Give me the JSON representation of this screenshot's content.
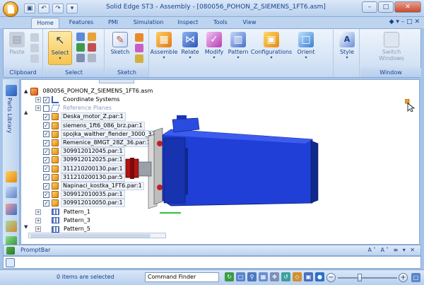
{
  "window": {
    "title": "Solid Edge ST3 - Assembly - [080056_POHON_Z_SIEMENS_1FT6.asm]",
    "minimize": "–",
    "maximize": "□",
    "close": "✕"
  },
  "qat": [
    "▣",
    "↶",
    "↷",
    "▾"
  ],
  "tabs": [
    {
      "label": "Home",
      "active": true
    },
    {
      "label": "Features"
    },
    {
      "label": "PMI"
    },
    {
      "label": "Simulation"
    },
    {
      "label": "Inspect"
    },
    {
      "label": "Tools"
    },
    {
      "label": "View"
    }
  ],
  "tabs_right": "◆ ▾ – □ ✕",
  "ribbon": {
    "groups": {
      "clipboard": "Clipboard",
      "select": "Select",
      "sketch": "Sketch",
      "window": "Window"
    },
    "buttons": {
      "paste": "Paste",
      "select": "Select",
      "sketch": "Sketch",
      "assemble": "Assemble",
      "relate": "Relate",
      "modify": "Modify",
      "pattern": "Pattern",
      "configurations": "Configurations",
      "orient": "Orient",
      "style": "Style",
      "switch_windows_1": "Switch",
      "switch_windows_2": "Windows"
    },
    "dropdown_marker": "▾"
  },
  "leftstrip": {
    "parts_library": "Parts Library"
  },
  "tree": {
    "root": "080056_POHON_Z_SIEMENS_1FT6.asm",
    "items": [
      {
        "label": "Coordinate Systems",
        "type": "coord",
        "checked": true,
        "expander": "+"
      },
      {
        "label": "Reference Planes",
        "type": "plane",
        "checked": false,
        "expander": "+"
      },
      {
        "label": "Deska_motor_Z.par:1",
        "type": "part",
        "checked": true
      },
      {
        "label": "siemens_1ft6_086_brz.par:1",
        "type": "part",
        "checked": true
      },
      {
        "label": "spojka_walther_flender_3000_32:",
        "type": "part",
        "checked": true
      },
      {
        "label": "Remenice_8MGT_28Z_36.par:1",
        "type": "part",
        "checked": true
      },
      {
        "label": "309912012045.par:1",
        "type": "part",
        "checked": true
      },
      {
        "label": "309912012025.par:1",
        "type": "part",
        "checked": true
      },
      {
        "label": "311210200130.par:1",
        "type": "part",
        "checked": true
      },
      {
        "label": "311210200130.par:5",
        "type": "part",
        "checked": true
      },
      {
        "label": "Napinaci_kostka_1FT6.par:1",
        "type": "part",
        "checked": true
      },
      {
        "label": "309912010035.par:1",
        "type": "part",
        "checked": true
      },
      {
        "label": "309912010050.par:1",
        "type": "part",
        "checked": true
      },
      {
        "label": "Pattern_1",
        "type": "pattern",
        "expander": "+"
      },
      {
        "label": "Pattern_3",
        "type": "pattern",
        "expander": "+"
      },
      {
        "label": "Pattern_5",
        "type": "pattern",
        "expander": "+"
      }
    ]
  },
  "promptbar": {
    "title": "PromptBar",
    "tools": "A˄ A˅ ≡ ▾ ✕"
  },
  "status": {
    "selection": "0 items are selected",
    "command_finder_placeholder": "Command Finder",
    "zoom_minus": "−",
    "zoom_plus": "+"
  },
  "colors": {
    "motor_blue": "#1f3fd6",
    "motor_dark": "#0f2a8a",
    "accent_select": "#f7c44f"
  }
}
